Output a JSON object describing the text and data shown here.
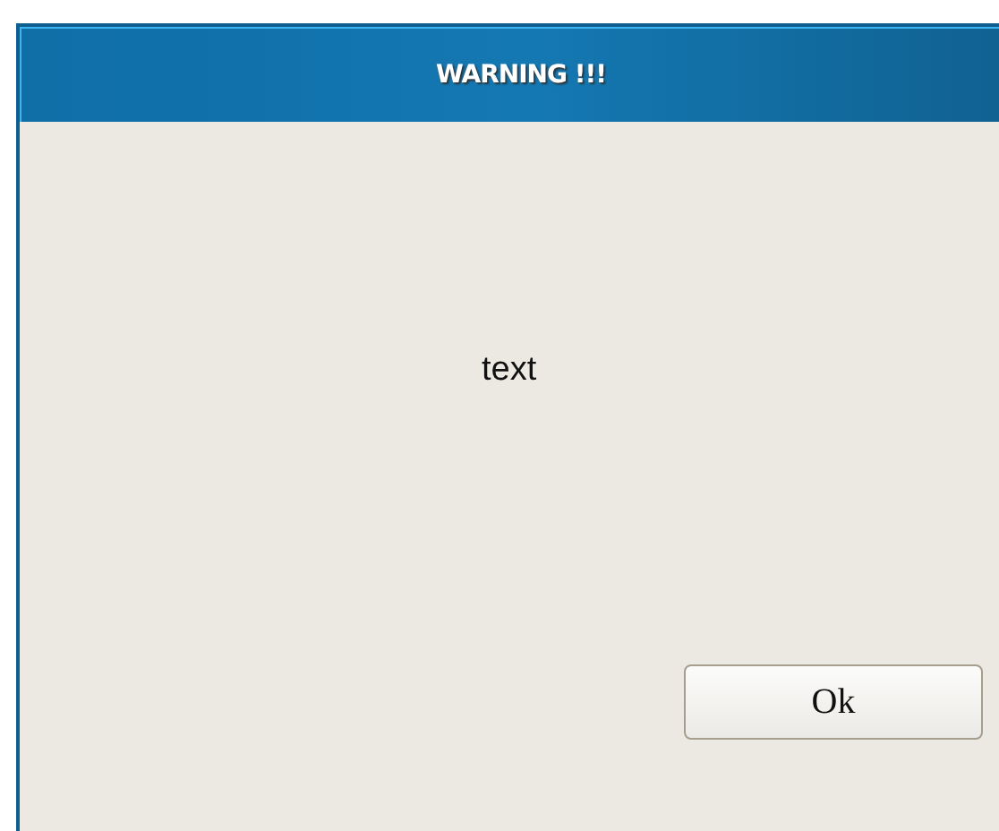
{
  "window": {
    "title": "WARNING !!!"
  },
  "message": "text",
  "buttons": [
    "Ok"
  ]
}
